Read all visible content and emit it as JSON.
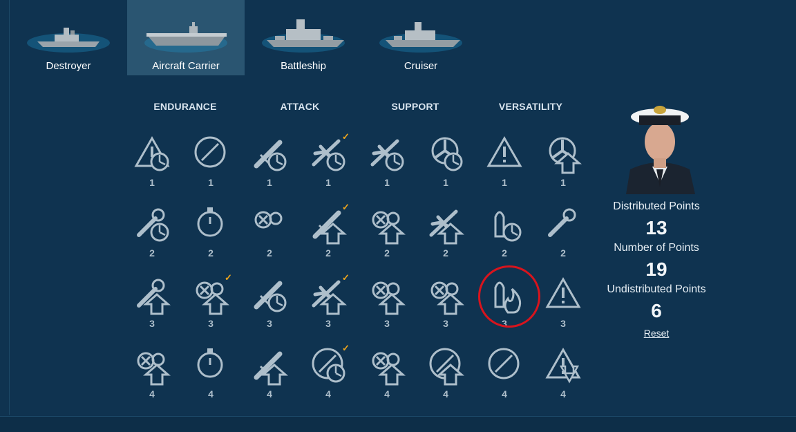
{
  "tabs": [
    {
      "label": "Destroyer",
      "active": false
    },
    {
      "label": "Aircraft Carrier",
      "active": true
    },
    {
      "label": "Battleship",
      "active": false
    },
    {
      "label": "Cruiser",
      "active": false
    }
  ],
  "columns": [
    "ENDURANCE",
    "ATTACK",
    "SUPPORT",
    "VERSATILITY"
  ],
  "skills": [
    [
      {
        "icon": "warning-target-icon",
        "cost": "1",
        "selected": false
      },
      {
        "icon": "no-lightning-icon",
        "cost": "1",
        "selected": false
      },
      {
        "icon": "torpedo-timer-icon",
        "cost": "1",
        "selected": false
      },
      {
        "icon": "fighter-timer-icon",
        "cost": "1",
        "selected": true
      },
      {
        "icon": "fighter-squadron-target-icon",
        "cost": "1",
        "selected": false
      },
      {
        "icon": "propeller-timer-icon",
        "cost": "1",
        "selected": false
      },
      {
        "icon": "shell-warning-icon",
        "cost": "1",
        "selected": false
      },
      {
        "icon": "propeller-upgrade-icon",
        "cost": "1",
        "selected": false
      }
    ],
    [
      {
        "icon": "wrench-timer-icon",
        "cost": "2",
        "selected": false
      },
      {
        "icon": "stopwatch-icon",
        "cost": "2",
        "selected": false
      },
      {
        "icon": "aa-guns-icon",
        "cost": "2",
        "selected": false
      },
      {
        "icon": "rocket-upgrade-icon",
        "cost": "2",
        "selected": true
      },
      {
        "icon": "armor-upgrade-icon",
        "cost": "2",
        "selected": false
      },
      {
        "icon": "plane-upgrade-icon",
        "cost": "2",
        "selected": false
      },
      {
        "icon": "shells-timer-icon",
        "cost": "2",
        "selected": false
      },
      {
        "icon": "gears-wrench-icon",
        "cost": "2",
        "selected": false
      }
    ],
    [
      {
        "icon": "wrench-upgrade-icon",
        "cost": "3",
        "selected": false
      },
      {
        "icon": "carrier-air-upgrade-icon",
        "cost": "3",
        "selected": true
      },
      {
        "icon": "torpedo-timer-icon",
        "cost": "3",
        "selected": false
      },
      {
        "icon": "bomber-upgrade-icon",
        "cost": "3",
        "selected": true
      },
      {
        "icon": "aa-bombs-upgrade-icon",
        "cost": "3",
        "selected": false
      },
      {
        "icon": "aa-heal-upgrade-icon",
        "cost": "3",
        "selected": false
      },
      {
        "icon": "shell-fire-icon",
        "cost": "3",
        "selected": false
      },
      {
        "icon": "torpedo-warning-icon",
        "cost": "3",
        "selected": false
      }
    ],
    [
      {
        "icon": "bombs-upgrade-icon",
        "cost": "4",
        "selected": false
      },
      {
        "icon": "extinguisher-icon",
        "cost": "4",
        "selected": false
      },
      {
        "icon": "crossed-upgrade-icon",
        "cost": "4",
        "selected": false
      },
      {
        "icon": "crosshair-timer-icon",
        "cost": "4",
        "selected": true
      },
      {
        "icon": "aa-bombs-upgrade-icon",
        "cost": "4",
        "selected": false
      },
      {
        "icon": "sight-upgrade-icon",
        "cost": "4",
        "selected": false
      },
      {
        "icon": "radar-icon",
        "cost": "4",
        "selected": false
      },
      {
        "icon": "warning-down-icon",
        "cost": "4",
        "selected": false
      }
    ]
  ],
  "commander": {
    "distributed_label": "Distributed Points",
    "distributed_value": "13",
    "number_label": "Number of Points",
    "number_value": "19",
    "undistributed_label": "Undistributed Points",
    "undistributed_value": "6",
    "reset_label": "Reset"
  },
  "colors": {
    "background": "#0f3350",
    "active_tab": "#2a5571",
    "check": "#f0a61b",
    "highlight_ring": "#d8141d",
    "icon": "#aebfcb"
  }
}
